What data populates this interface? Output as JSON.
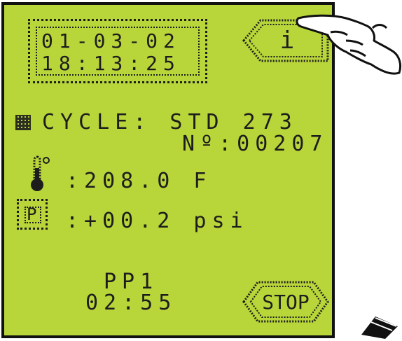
{
  "display": {
    "date": "01-03-02",
    "time": "18:13:25",
    "info_button_label": "i",
    "cycle_line": "CYCLE: STD 273",
    "serial_line": "Nº:00207",
    "temperature_line": ":208.0 F",
    "pressure_badge": "P",
    "pressure_line": ":+00.2 psi",
    "program_name": "PP1",
    "countdown": "02:55",
    "stop_button_label": "STOP"
  },
  "colors": {
    "lcd_background": "#b8d63a",
    "segment_ink": "#1d1d1d",
    "bezel": "#111111"
  },
  "icons": {
    "temperature": "thermometer-icon",
    "pointer": "pointing-hand-icon",
    "tool": "stylus-icon"
  }
}
